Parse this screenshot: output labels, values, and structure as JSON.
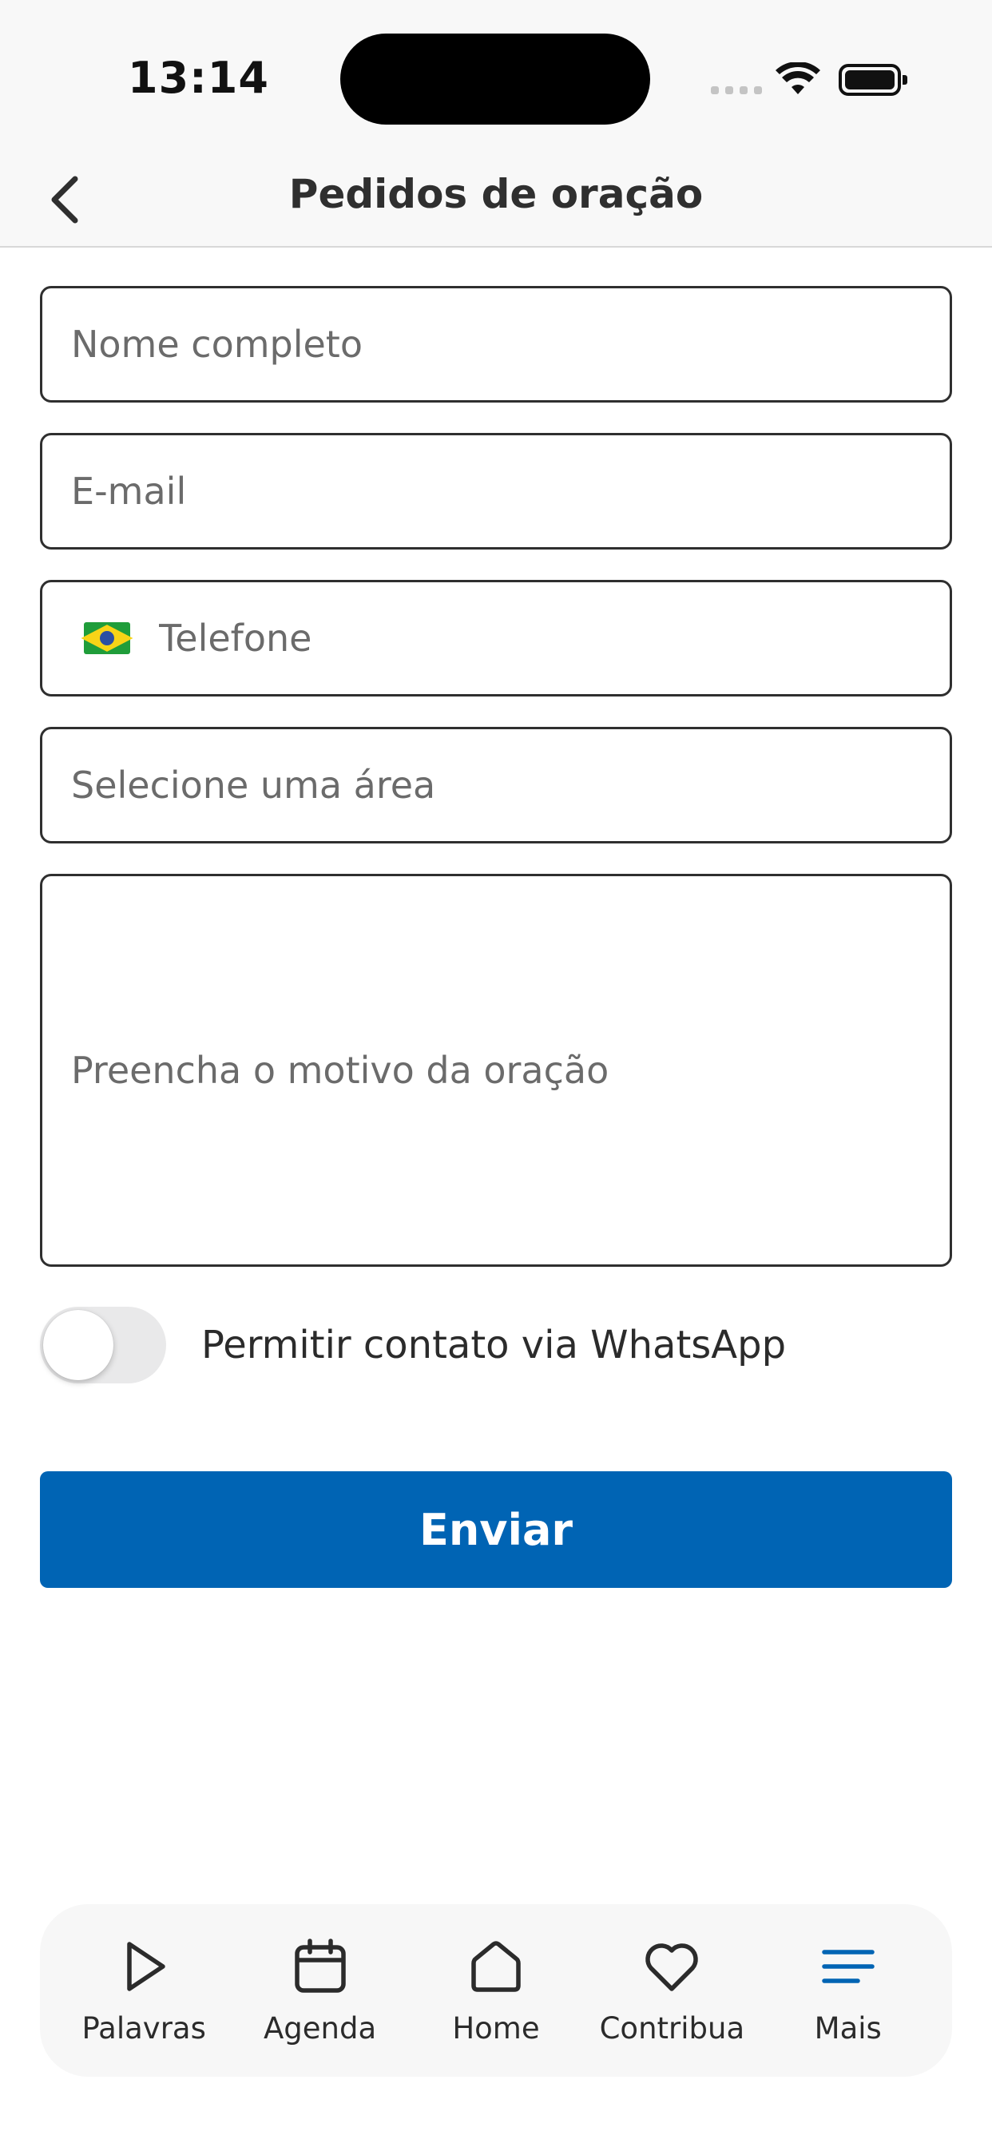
{
  "status_bar": {
    "time": "13:14"
  },
  "header": {
    "title": "Pedidos de oração"
  },
  "form": {
    "name_placeholder": "Nome completo",
    "email_placeholder": "E-mail",
    "phone_placeholder": "Telefone",
    "phone_country": "Brazil",
    "area_placeholder": "Selecione uma área",
    "reason_placeholder": "Preencha o motivo da oração",
    "whatsapp_toggle_label": "Permitir contato via WhatsApp",
    "whatsapp_toggle_on": false,
    "submit_label": "Enviar"
  },
  "tab_bar": {
    "items": [
      {
        "label": "Palavras",
        "icon": "play-icon"
      },
      {
        "label": "Agenda",
        "icon": "calendar-icon"
      },
      {
        "label": "Home",
        "icon": "home-icon"
      },
      {
        "label": "Contribua",
        "icon": "heart-icon"
      },
      {
        "label": "Mais",
        "icon": "menu-icon",
        "active": true
      }
    ]
  },
  "colors": {
    "primary": "#0064b4",
    "text": "#2b2b2b",
    "placeholder": "#6b6b6b",
    "border": "#2f2f2f",
    "toggle_off": "#e9e9ea"
  }
}
